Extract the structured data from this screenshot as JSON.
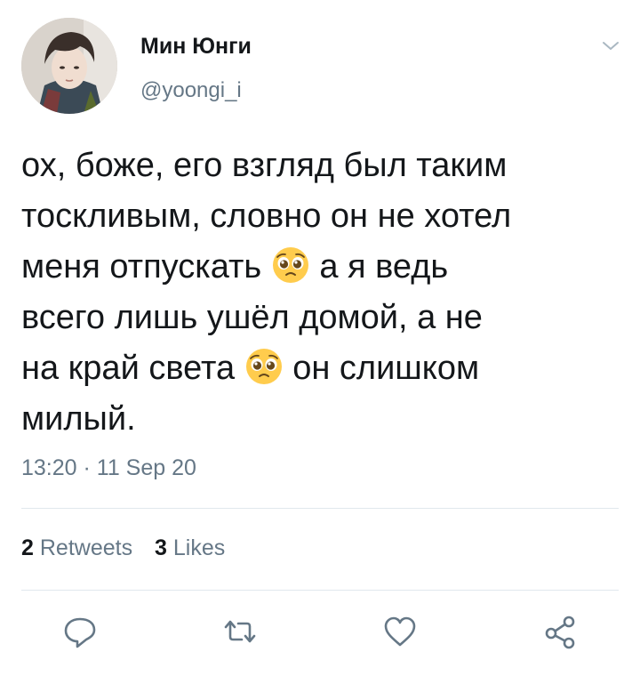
{
  "tweet": {
    "display_name": "Мин Юнги",
    "handle": "@yoongi_i",
    "text_lines": [
      "ох, боже, его взгляд был таким",
      "тоскливым, словно он не хотел",
      "меня отпускать",
      "а я ведь",
      "всего лишь ушёл домой, а не",
      "на край света",
      "он слишком",
      "милый."
    ],
    "emoji": "pleading-face-emoji",
    "timestamp": "13:20 · 11 Sep 20",
    "retweets_count": "2",
    "retweets_label": "Retweets",
    "likes_count": "3",
    "likes_label": "Likes"
  },
  "icons": {
    "menu": "chevron-down-icon",
    "reply": "reply-icon",
    "retweet": "retweet-icon",
    "like": "heart-icon",
    "share": "share-icon"
  },
  "colors": {
    "text": "#14171a",
    "secondary": "#657786",
    "divider": "#e1e8ed",
    "emoji_face": "#ffcc4d"
  }
}
